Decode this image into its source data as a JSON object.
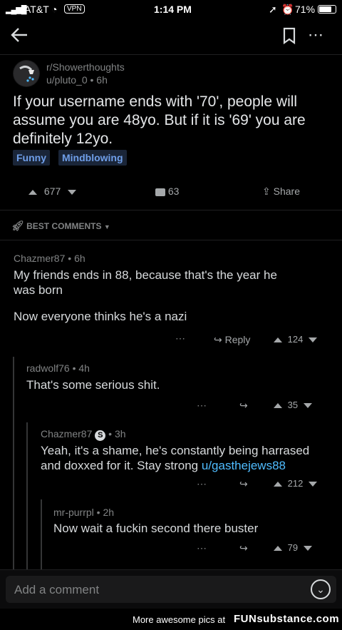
{
  "status": {
    "carrier": "AT&T",
    "vpn": "VPN",
    "time": "1:14 PM",
    "battery": "71%"
  },
  "post": {
    "subreddit": "r/Showerthoughts",
    "author": "u/pluto_0",
    "age": "6h",
    "title": "If your username ends with '70', people will assume you are 48yo. But if it is '69' you are definitely 12yo.",
    "flairs": [
      "Funny",
      "Mindblowing"
    ],
    "votes": "677",
    "comments": "63",
    "share_label": "Share"
  },
  "sort_label": "BEST COMMENTS",
  "comments": [
    {
      "author": "Chazmer87",
      "age": "6h",
      "text_line1": "My friends ends in 88, because that's the year he",
      "text_line2": "was born",
      "text_line3": "Now everyone thinks he's a nazi",
      "reply_label": "Reply",
      "votes": "124"
    },
    {
      "author": "radwolf76",
      "age": "4h",
      "text": "That's some serious shit.",
      "votes": "35"
    },
    {
      "author": "Chazmer87",
      "age": "3h",
      "text_line1": "Yeah, it's a shame, he's constantly being harrased",
      "text_line2": "and doxxed for it.  Stay strong",
      "link": "u/gasthejews88",
      "votes": "212"
    },
    {
      "author": "mr-purrpl",
      "age": "2h",
      "text": "Now wait a fuckin second there buster",
      "votes": "79"
    }
  ],
  "composer": {
    "placeholder": "Add a comment"
  },
  "footer": {
    "text": "More awesome pics at",
    "brand": "FUNsubstance.com"
  },
  "colors": {
    "background": "#000000",
    "text": "#d7dadc",
    "muted": "#818384",
    "link": "#4fbcff",
    "flair": "#6f9ee8"
  }
}
